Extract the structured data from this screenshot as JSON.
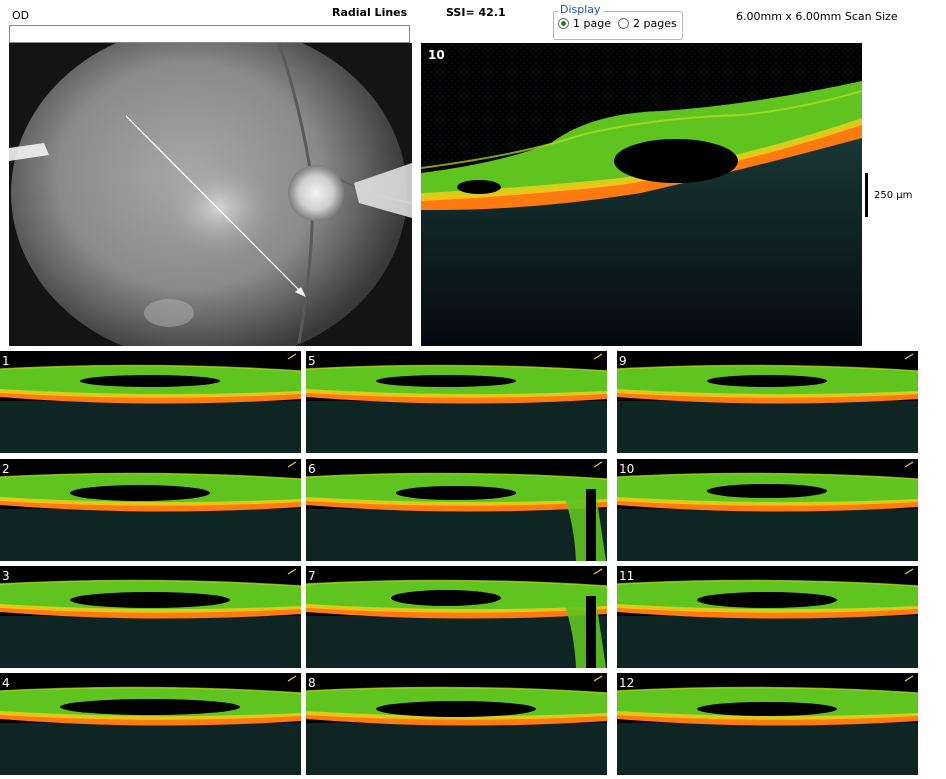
{
  "header": {
    "eye": "OD",
    "scan_type": "Radial Lines",
    "ssi": "SSI= 42.1",
    "scan_size": "6.00mm x 6.00mm Scan Size"
  },
  "display": {
    "legend": "Display",
    "options": [
      "1 page",
      "2 pages"
    ],
    "selected": "1 page"
  },
  "main_scan": {
    "number": "10",
    "scale_label": "250 µm"
  },
  "thumbnails": [
    "1",
    "2",
    "3",
    "4",
    "5",
    "6",
    "7",
    "8",
    "9",
    "10",
    "11",
    "12"
  ],
  "colors": {
    "background": "#000000",
    "retina_green": "#5fc420",
    "rpe_orange": "#ff7a10",
    "selected_radio": "#2a7a2a"
  }
}
